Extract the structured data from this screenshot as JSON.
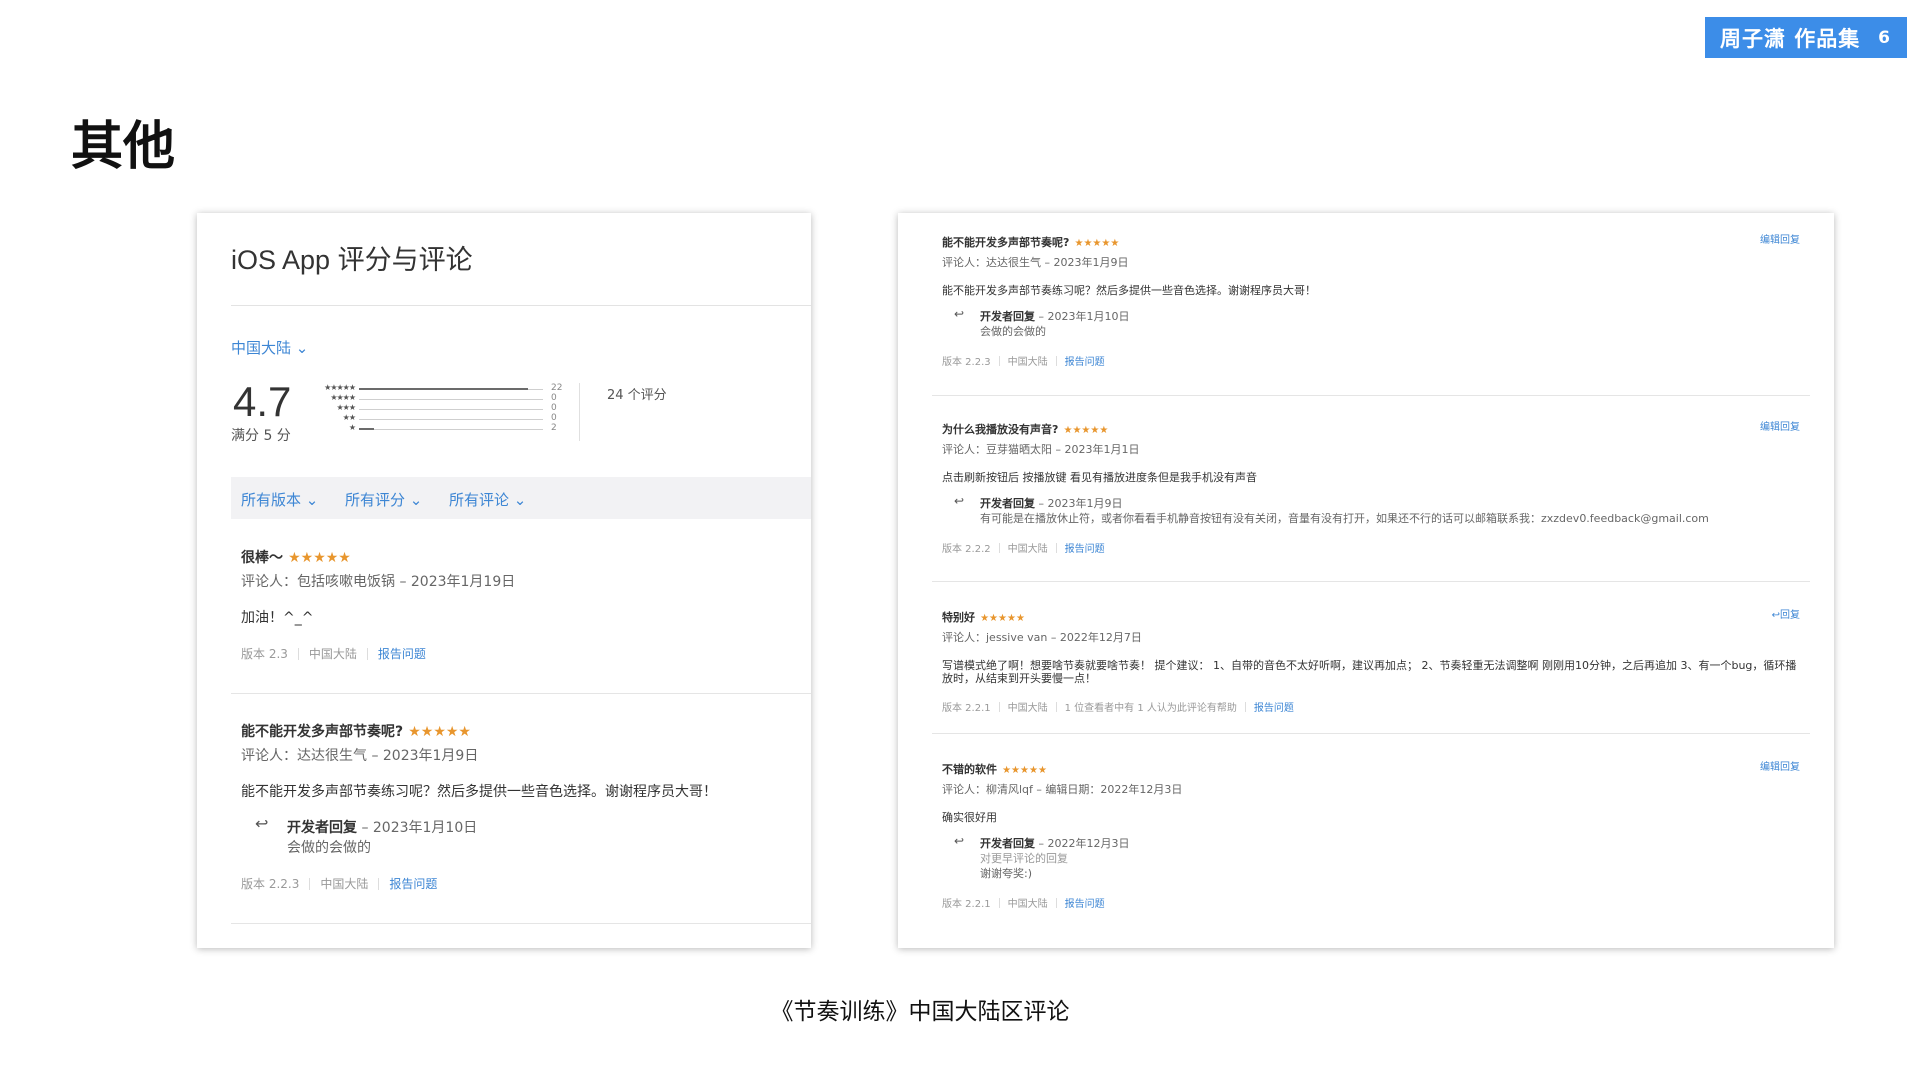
{
  "badge": {
    "title": "周子潇 作品集",
    "page": "6"
  },
  "page_title": "其他",
  "caption": "《节奏训练》中国大陆区评论",
  "left": {
    "title": "iOS App 评分与评论",
    "region": "中国大陆 ⌄",
    "rating": "4.7",
    "out_of": "满分 5 分",
    "total": "24 个评分",
    "histogram": [
      {
        "stars": "★★★★★",
        "count": "22",
        "fraction": 0.92
      },
      {
        "stars": "★★★★",
        "count": "0",
        "fraction": 0
      },
      {
        "stars": "★★★",
        "count": "0",
        "fraction": 0
      },
      {
        "stars": "★★",
        "count": "0",
        "fraction": 0
      },
      {
        "stars": "★",
        "count": "2",
        "fraction": 0.08
      }
    ],
    "filters": [
      "所有版本 ⌄",
      "所有评分 ⌄",
      "所有评论 ⌄"
    ],
    "reviews": [
      {
        "title": "很棒～",
        "stars": "★★★★★",
        "meta": "评论人：包括咳嗽电饭锅 – 2023年1月19日",
        "body": "加油！^_^",
        "footer": [
          "版本 2.3",
          "中国大陆"
        ],
        "link": "报告问题"
      },
      {
        "title": "能不能开发多声部节奏呢?",
        "stars": "★★★★★",
        "meta": "评论人：达达很生气 – 2023年1月9日",
        "body": "能不能开发多声部节奏练习呢？然后多提供一些音色选择。谢谢程序员大哥！",
        "reply_label": "开发者回复",
        "reply_date": " – 2023年1月10日",
        "reply_text": "会做的会做的",
        "footer": [
          "版本 2.2.3",
          "中国大陆"
        ],
        "link": "报告问题"
      }
    ]
  },
  "right": {
    "reviews": [
      {
        "title": "能不能开发多声部节奏呢?",
        "stars": "★★★★★",
        "meta": "评论人：达达很生气 – 2023年1月9日",
        "body": "能不能开发多声部节奏练习呢？然后多提供一些音色选择。谢谢程序员大哥！",
        "reply_label": "开发者回复",
        "reply_date": " – 2023年1月10日",
        "reply_text": "会做的会做的",
        "footer": [
          "版本 2.2.3",
          "中国大陆"
        ],
        "link": "报告问题",
        "action": "编辑回复"
      },
      {
        "title": "为什么我播放没有声音?",
        "stars": "★★★★★",
        "meta": "评论人：豆芽猫晒太阳 – 2023年1月1日",
        "body": "点击刷新按钮后 按播放键 看见有播放进度条但是我手机没有声音",
        "reply_label": "开发者回复",
        "reply_date": " – 2023年1月9日",
        "reply_text": "有可能是在播放休止符，或者你看看手机静音按钮有没有关闭，音量有没有打开，如果还不行的话可以邮箱联系我：zxzdev0.feedback@gmail.com",
        "footer": [
          "版本 2.2.2",
          "中国大陆"
        ],
        "link": "报告问题",
        "action": "编辑回复"
      },
      {
        "title": "特别好",
        "stars": "★★★★★",
        "meta": "评论人：jessive van – 2022年12月7日",
        "body": "写谱模式绝了啊！想要啥节奏就要啥节奏！ 提个建议： 1、自带的音色不太好听啊，建议再加点； 2、节奏轻重无法调整啊 刚刚用10分钟，之后再追加 3、有一个bug，循环播放时，从结束到开头要慢一点！",
        "footer": [
          "版本 2.2.1",
          "中国大陆",
          "1 位查看者中有 1 人认为此评论有帮助"
        ],
        "link": "报告问题",
        "action": "回复"
      },
      {
        "title": "不错的软件",
        "stars": "★★★★★",
        "meta": "评论人：柳清风lqf – 编辑日期：2022年12月3日",
        "body": "确实很好用",
        "reply_label": "开发者回复",
        "reply_date": " – 2022年12月3日",
        "reply_note": "对更早评论的回复",
        "reply_text": "谢谢夸奖:)",
        "footer": [
          "版本 2.2.1",
          "中国大陆"
        ],
        "link": "报告问题",
        "action": "编辑回复"
      }
    ]
  }
}
